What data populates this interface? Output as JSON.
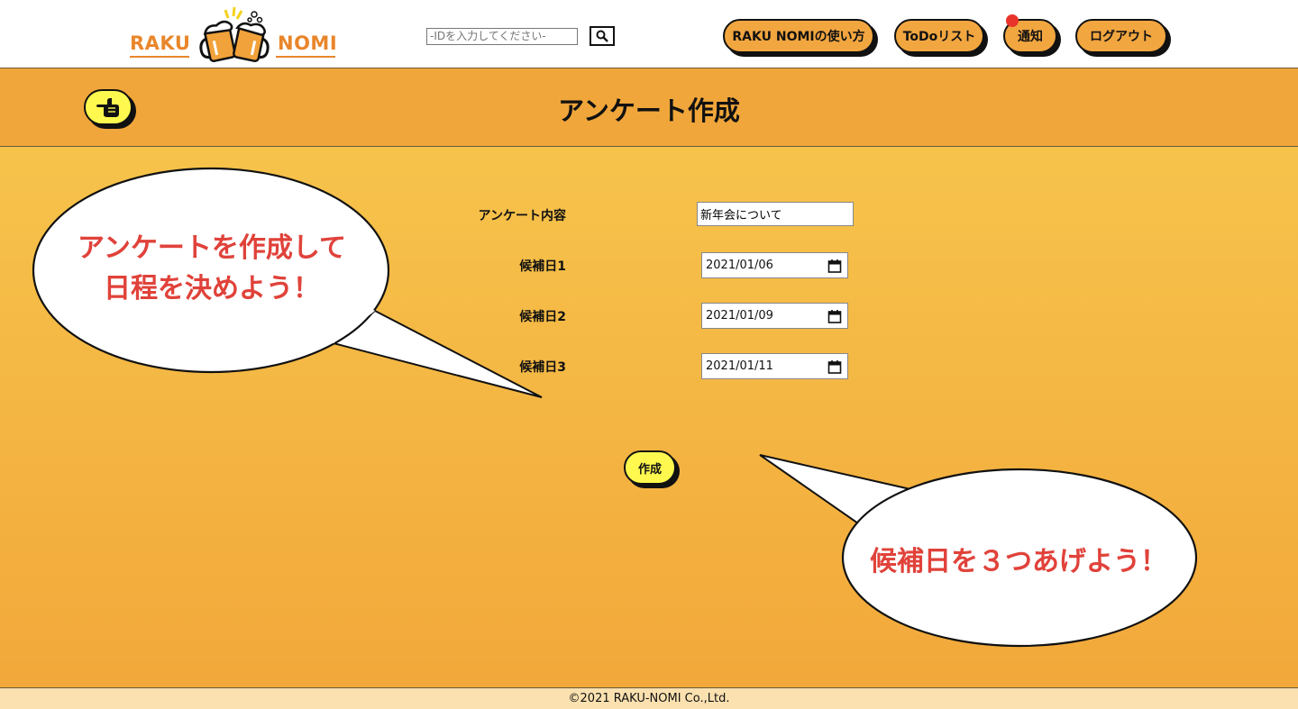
{
  "header": {
    "logo": {
      "left_word": "RAKU",
      "right_word": "NOMI"
    },
    "search": {
      "placeholder": "-IDを入力してください-"
    },
    "nav": {
      "guide_label": "RAKU NOMIの使い方",
      "todo_label": "ToDoリスト",
      "notifications_label": "通知",
      "logout_label": "ログアウト"
    }
  },
  "titlebar": {
    "title": "アンケート作成"
  },
  "form": {
    "content_label": "アンケート内容",
    "content_value": "新年会について",
    "candidates": [
      {
        "label": "候補日1",
        "value": "2021/01/06"
      },
      {
        "label": "候補日2",
        "value": "2021/01/09"
      },
      {
        "label": "候補日3",
        "value": "2021/01/11"
      }
    ],
    "submit_label": "作成"
  },
  "bubbles": {
    "left_line1": "アンケートを作成して",
    "left_line2": "日程を決めよう！",
    "right_text": "候補日を３つあげよう！"
  },
  "footer": {
    "copyright": "©2021 RAKU-NOMI Co.,Ltd."
  },
  "colors": {
    "brand_orange": "#e9862b",
    "button_orange": "#f2a640",
    "button_yellow": "#fff94f",
    "bubble_text": "#e0423a",
    "notification_dot": "#e8332b"
  }
}
